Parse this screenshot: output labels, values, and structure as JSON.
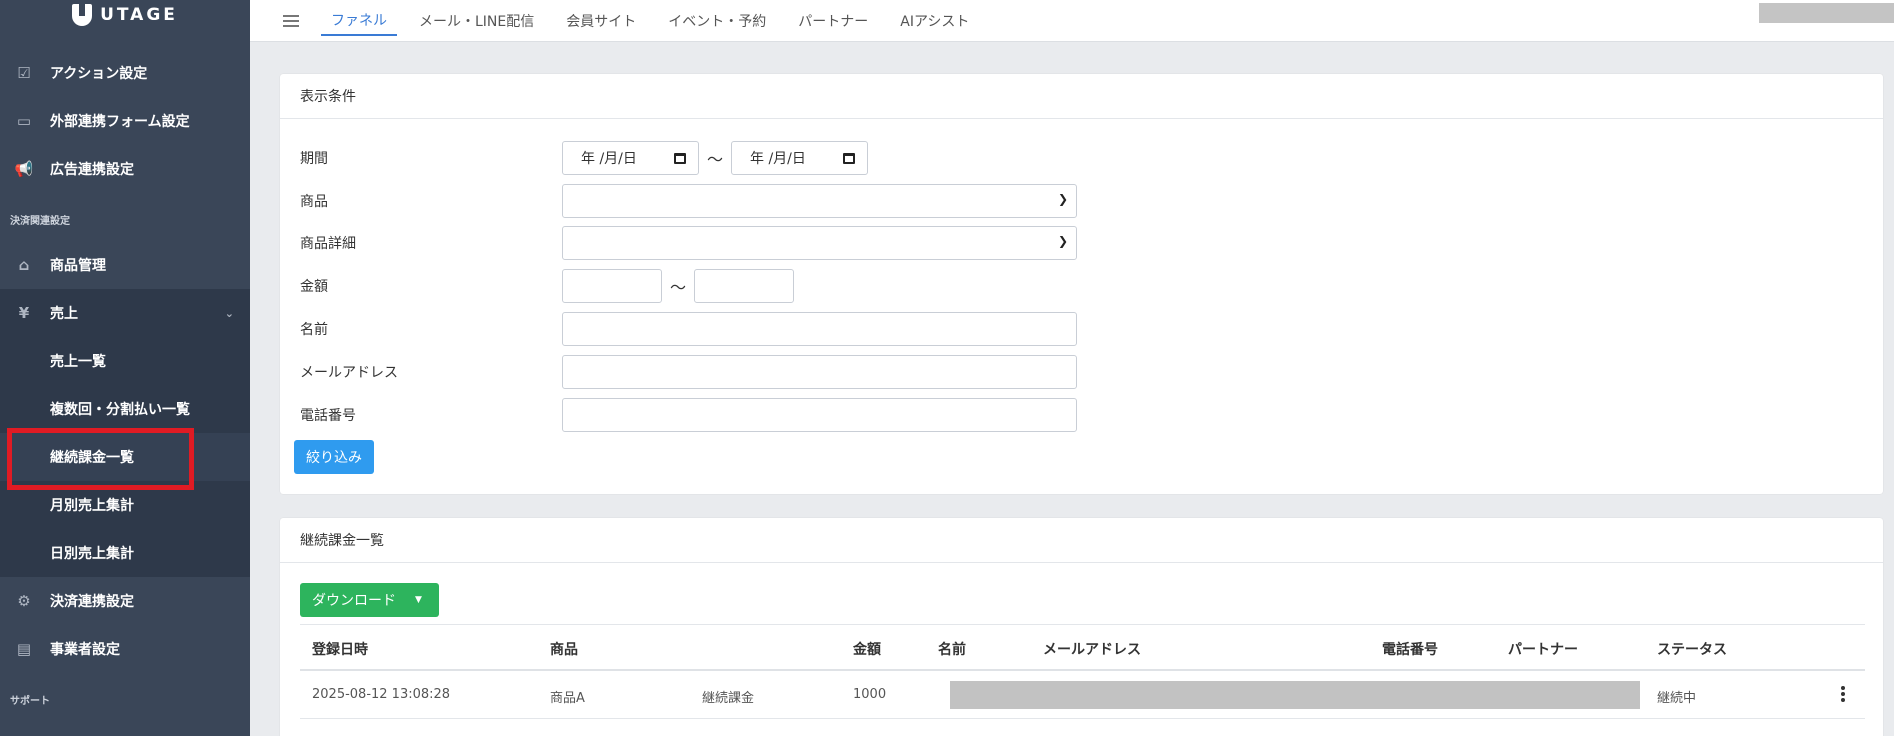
{
  "brand": {
    "name": "UTAGE"
  },
  "sidebar": {
    "items_top": [
      {
        "label": "アクション設定",
        "icon": "checkbox-icon"
      },
      {
        "label": "外部連携フォーム設定",
        "icon": "form-icon"
      },
      {
        "label": "広告連携設定",
        "icon": "megaphone-icon"
      }
    ],
    "section_payment": "決済関連設定",
    "product_mgmt": "商品管理",
    "sales": "売上",
    "sales_icon": "¥",
    "sub_items": [
      "売上一覧",
      "複数回・分割払い一覧",
      "継続課金一覧",
      "月別売上集計",
      "日別売上集計"
    ],
    "payment_integration": "決済連携設定",
    "business_settings": "事業者設定",
    "section_support": "サポート"
  },
  "header": {
    "tabs": [
      "ファネル",
      "メール・LINE配信",
      "会員サイト",
      "イベント・予約",
      "パートナー",
      "AIアシスト"
    ]
  },
  "filter": {
    "title": "表示条件",
    "period_label": "期間",
    "date_placeholder": "年 /月/日",
    "tilde": "～",
    "product_label": "商品",
    "product_detail_label": "商品詳細",
    "amount_label": "金額",
    "name_label": "名前",
    "email_label": "メールアドレス",
    "phone_label": "電話番号",
    "submit": "絞り込み"
  },
  "list": {
    "title": "継続課金一覧",
    "download": "ダウンロード",
    "columns": [
      "登録日時",
      "商品",
      "金額",
      "名前",
      "メールアドレス",
      "電話番号",
      "パートナー",
      "ステータス"
    ],
    "rows": [
      {
        "date": "2025-08-12 13:08:28",
        "product": "商品A",
        "product_detail": "継続課金",
        "amount": "1000",
        "status": "継続中"
      }
    ]
  },
  "colors": {
    "accent": "#3a7bd5",
    "sidebar": "#3a4658",
    "primary_button": "#2f9bef",
    "download_button": "#2db45d",
    "highlight": "#e01b24"
  }
}
